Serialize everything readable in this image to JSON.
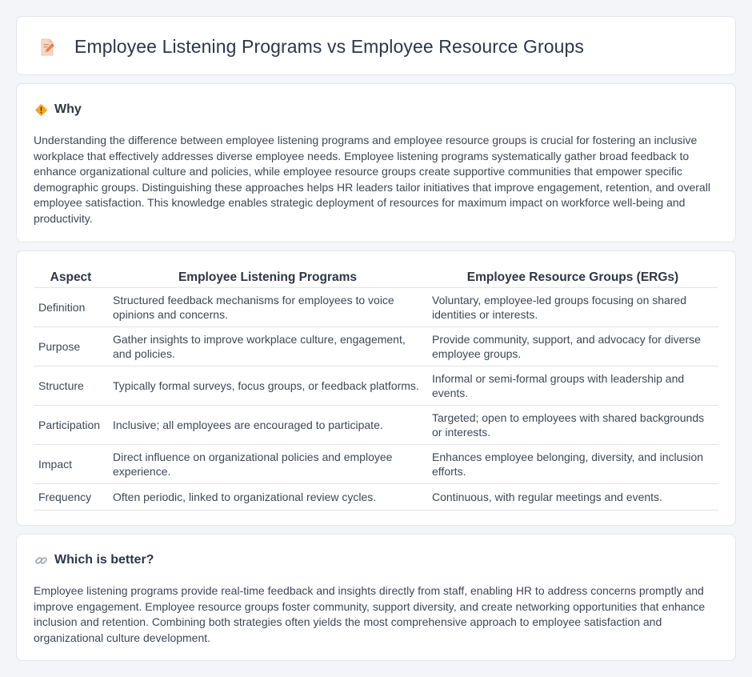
{
  "page": {
    "title": "Employee Listening Programs vs Employee Resource Groups",
    "title_icon": "edit-document-icon"
  },
  "why": {
    "icon": "diamond-warning-icon",
    "title": "Why",
    "text": "Understanding the difference between employee listening programs and employee resource groups is crucial for fostering an inclusive workplace that effectively addresses diverse employee needs. Employee listening programs systematically gather broad feedback to enhance organizational culture and policies, while employee resource groups create supportive communities that empower specific demographic groups. Distinguishing these approaches helps HR leaders tailor initiatives that improve engagement, retention, and overall employee satisfaction. This knowledge enables strategic deployment of resources for maximum impact on workforce well-being and productivity."
  },
  "table": {
    "headers": [
      "Aspect",
      "Employee Listening Programs",
      "Employee Resource Groups (ERGs)"
    ],
    "rows": [
      [
        "Definition",
        "Structured feedback mechanisms for employees to voice opinions and concerns.",
        "Voluntary, employee-led groups focusing on shared identities or interests."
      ],
      [
        "Purpose",
        "Gather insights to improve workplace culture, engagement, and policies.",
        "Provide community, support, and advocacy for diverse employee groups."
      ],
      [
        "Structure",
        "Typically formal surveys, focus groups, or feedback platforms.",
        "Informal or semi-formal groups with leadership and events."
      ],
      [
        "Participation",
        "Inclusive; all employees are encouraged to participate.",
        "Targeted; open to employees with shared backgrounds or interests."
      ],
      [
        "Impact",
        "Direct influence on organizational policies and employee experience.",
        "Enhances employee belonging, diversity, and inclusion efforts."
      ],
      [
        "Frequency",
        "Often periodic, linked to organizational review cycles.",
        "Continuous, with regular meetings and events."
      ]
    ]
  },
  "better": {
    "icon": "link-icon",
    "title": "Which is better?",
    "text": "Employee listening programs provide real-time feedback and insights directly from staff, enabling HR to address concerns promptly and improve engagement. Employee resource groups foster community, support diversity, and create networking opportunities that enhance inclusion and retention. Combining both strategies often yields the most comprehensive approach to employee satisfaction and organizational culture development."
  },
  "colors": {
    "background": "#f3f5f9",
    "card": "#ffffff",
    "title_text": "#2d3748",
    "body_text": "#3f4754",
    "accent_orange": "#f0a030"
  }
}
